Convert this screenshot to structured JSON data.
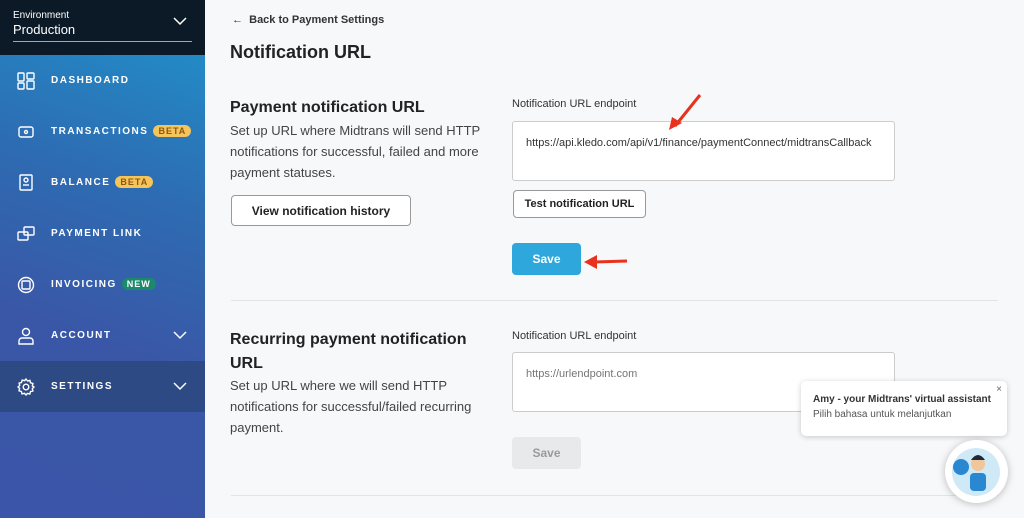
{
  "sidebar": {
    "environment_label": "Environment",
    "environment_value": "Production",
    "items": [
      {
        "label": "DASHBOARD",
        "icon": "dashboard-icon"
      },
      {
        "label": "TRANSACTIONS",
        "badge": "BETA",
        "icon": "transactions-icon"
      },
      {
        "label": "BALANCE",
        "badge": "BETA",
        "icon": "balance-icon"
      },
      {
        "label": "PAYMENT LINK",
        "icon": "payment-link-icon"
      },
      {
        "label": "INVOICING",
        "badge": "NEW",
        "icon": "invoicing-icon"
      },
      {
        "label": "ACCOUNT",
        "icon": "account-icon",
        "expandable": true
      },
      {
        "label": "SETTINGS",
        "icon": "gear-icon",
        "expandable": true,
        "active": true
      }
    ]
  },
  "main": {
    "back_label": "Back to Payment Settings",
    "title": "Notification URL",
    "payment": {
      "heading": "Payment notification URL",
      "description": "Set up URL where Midtrans will send HTTP notifications for successful, failed and more payment statuses.",
      "history_button": "View notification history",
      "field_label": "Notification URL endpoint",
      "field_value": "https://api.kledo.com/api/v1/finance/paymentConnect/midtransCallback",
      "test_button": "Test notification URL",
      "save_button": "Save"
    },
    "recurring": {
      "heading": "Recurring payment notification URL",
      "description": "Set up URL where we will send HTTP notifications for successful/failed recurring payment.",
      "field_label": "Notification URL endpoint",
      "field_placeholder": "https://urlendpoint.com",
      "save_button": "Save"
    }
  },
  "chat": {
    "title": "Amy - your Midtrans' virtual assistant",
    "subtitle": "Pilih bahasa untuk melanjutkan",
    "close": "×"
  },
  "colors": {
    "primary": "#2ea8dc",
    "annotation_arrow": "#e8321e",
    "beta": "#f5c45a",
    "new": "#1a8a6a"
  }
}
